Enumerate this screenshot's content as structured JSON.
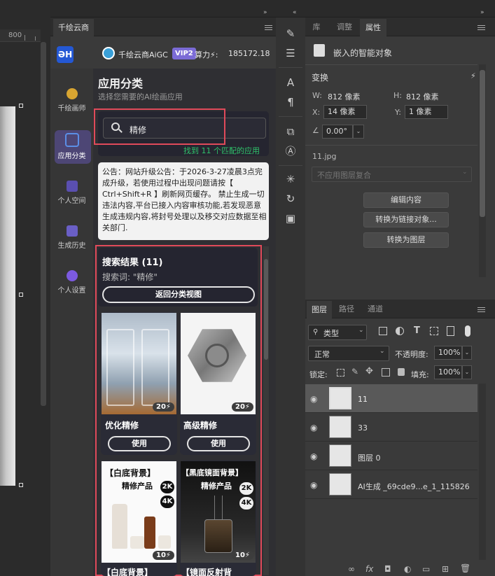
{
  "canvas": {
    "ruler_label": "800"
  },
  "plugin": {
    "tab_label": "千绘云商",
    "user_name": "千绘云商AiGC",
    "vip_badge": "VIP2",
    "compute_label": "算力⚡:",
    "compute_value": "185172.18",
    "nav": [
      {
        "label": "千绘画师"
      },
      {
        "label": "应用分类"
      },
      {
        "label": "个人空间"
      },
      {
        "label": "生成历史"
      },
      {
        "label": "个人设置"
      }
    ],
    "page_title": "应用分类",
    "page_subtitle": "选择您需要的AI绘画应用",
    "search_value": "精修",
    "search_result_hint": "找到 11 个匹配的应用",
    "notice": "公告：网站升级公告：于2026-3-27凌晨3点完成升级，若使用过程中出现问题请按【 Ctrl+Shift+R 】刷新网页缓存。 禁止生成一切违法内容,平台已接入内容审核功能,若发现恶意生成违规内容,将封号处理以及移交对应数据至相关部门.",
    "results_title": "搜索结果 (11)",
    "results_query": "搜索词: \"精修\"",
    "back_button": "返回分类视图",
    "cards": [
      {
        "title": "优化精修",
        "cost": "20⚡",
        "use": "使用"
      },
      {
        "title": "高级精修",
        "cost": "20⚡",
        "use": "使用"
      },
      {
        "title": "【白底背景】",
        "cost": "10⚡",
        "img_title": "【白底背景】",
        "img_sub": "精修产品",
        "res1": "2K",
        "res2": "4K"
      },
      {
        "title": "【镜面反射背",
        "cost": "10⚡",
        "img_title": "【黑底镜面背景】",
        "img_sub": "精修产品",
        "res1": "2K",
        "res2": "4K"
      }
    ]
  },
  "properties": {
    "tabs": [
      "库",
      "调整",
      "属性"
    ],
    "object_type": "嵌入的智能对象",
    "transform_label": "变换",
    "w_label": "W:",
    "w_value": "812 像素",
    "h_label": "H:",
    "h_value": "812 像素",
    "x_label": "X:",
    "x_value": "14 像素",
    "y_label": "Y:",
    "y_value": "1 像素",
    "angle_value": "0.00°",
    "file_name": "11.jpg",
    "comp_placeholder": "不应用图层复合",
    "btn_edit": "编辑内容",
    "btn_link": "转换为链接对象...",
    "btn_layer": "转换为图层"
  },
  "layers": {
    "tabs": [
      "图层",
      "路径",
      "通道"
    ],
    "filter_label": "类型",
    "blend_mode": "正常",
    "opacity_label": "不透明度:",
    "opacity_value": "100%",
    "lock_label": "锁定:",
    "fill_label": "填充:",
    "fill_value": "100%",
    "items": [
      {
        "name": "11"
      },
      {
        "name": "33"
      },
      {
        "name": "图层 0"
      },
      {
        "name": "AI生成 _69cde9...e_1_115826"
      }
    ],
    "footer_icons": [
      "∞",
      "fx",
      "◘",
      "◐",
      "▭",
      "⊞",
      "🗑"
    ]
  },
  "colors": {
    "highlight": "#e04a5a",
    "accent_green": "#2fc26a",
    "vip": "#7b6bd6"
  }
}
